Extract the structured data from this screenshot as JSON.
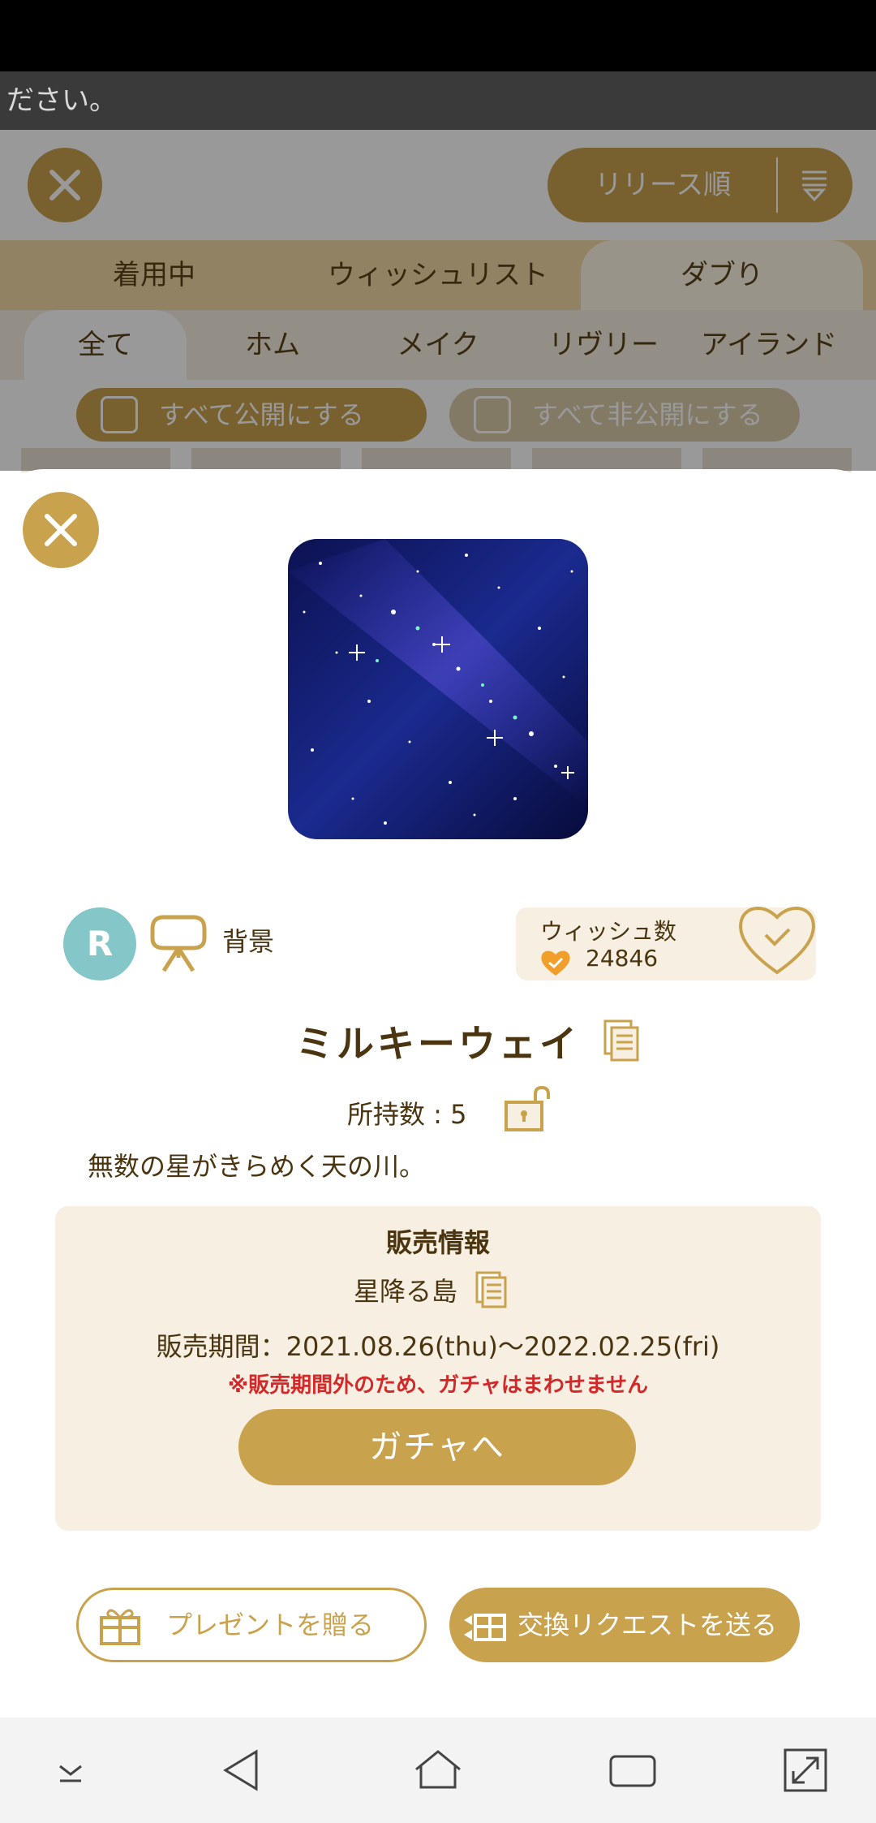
{
  "notice": {
    "text": "ださい。"
  },
  "background": {
    "sort_label": "リリース順",
    "tabs": [
      "着用中",
      "ウィッシュリスト",
      "ダブり"
    ],
    "subtabs": [
      "全て",
      "ホム",
      "メイク",
      "リヴリー",
      "アイランド"
    ],
    "publish_all_label": "すべて公開にする",
    "unpublish_all_label": "すべて非公開にする"
  },
  "item": {
    "rarity": "R",
    "category": "背景",
    "name": "ミルキーウェイ",
    "owned": "所持数 : 5",
    "description": "無数の星がきらめく天の川。"
  },
  "wish": {
    "title": "ウィッシュ数",
    "count": "24846"
  },
  "sale": {
    "title": "販売情報",
    "island": "星降る島",
    "period": "販売期間：2021.08.26(thu)〜2022.02.25(fri)",
    "warning": "※販売期間外のため、ガチャはまわせません",
    "gacha_label": "ガチャへ"
  },
  "actions": {
    "present_label": "プレゼントを贈る",
    "trade_label": "交換リクエストを送る"
  },
  "colors": {
    "accent": "#c9a24e",
    "panel": "#f7efe2",
    "text": "#4a3510",
    "warning": "#d22a2a",
    "rarity": "#85c6c9"
  },
  "icons": [
    "close-icon",
    "sort-icon",
    "checkbox-icon",
    "category-icon",
    "heart-icon",
    "document-icon",
    "unlock-icon",
    "gift-icon",
    "exchange-icon",
    "chevron-down-icon",
    "back-icon",
    "home-icon",
    "recents-icon",
    "expand-icon"
  ]
}
